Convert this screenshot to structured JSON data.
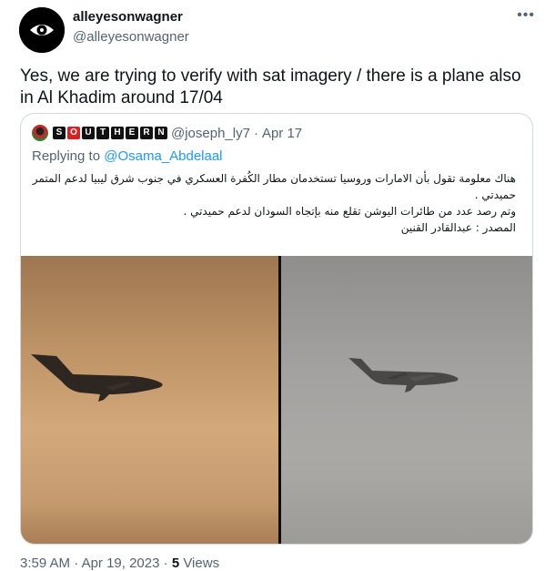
{
  "author": {
    "display_name": "alleyesonwagner",
    "handle": "@alleyesonwagner",
    "avatar_icon": "eye-logo-icon"
  },
  "more_label": "•••",
  "tweet": {
    "text": "Yes, we are trying to verify with sat imagery / there is a plane also in Al Khadim around 17/04"
  },
  "quoted": {
    "name_letters": [
      "S",
      "O",
      "U",
      "T",
      "H",
      "E",
      "R",
      "N"
    ],
    "handle": "@joseph_ly7",
    "separator": "·",
    "date": "Apr 17",
    "replying_prefix": "Replying to",
    "replying_to": "@Osama_Abdelaal",
    "arabic_lines": [
      "هناك معلومة تقول بأن الامارات وروسيا تستخدمان مطار الكُفرة العسكري في  جنوب شرق ليبيا لدعم المتمرد",
      "حميدتي .",
      "وتم رصد عدد من طائرات اليوشن تقلع منه بإتجاه السودان  لدعم حميدتي .",
      "المصدر : عبدالقادر القنين"
    ],
    "images": [
      {
        "name": "plane-photo-left",
        "icon": "airplane-silhouette"
      },
      {
        "name": "plane-photo-right",
        "icon": "airplane-silhouette"
      }
    ]
  },
  "footer": {
    "time": "3:59 AM",
    "separator": "·",
    "date": "Apr 19, 2023",
    "views_count": "5",
    "views_label": "Views"
  },
  "colors": {
    "link": "#1d9bf0",
    "secondary_text": "#536471",
    "border": "#cfd9de",
    "brand_red": "#d62222"
  }
}
